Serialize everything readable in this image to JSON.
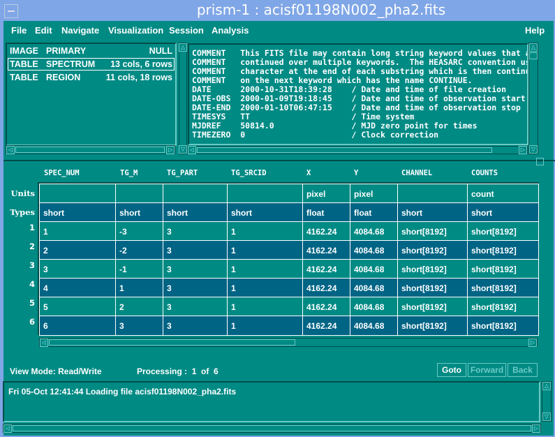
{
  "window": {
    "title": "prism-1  : acisf01198N002_pha2.fits"
  },
  "menu": [
    "File",
    "Edit",
    "Navigate",
    "Visualization",
    "Session",
    "Analysis",
    "Help"
  ],
  "hdus": [
    {
      "type": "IMAGE",
      "name": "PRIMARY",
      "info": "NULL"
    },
    {
      "type": "TABLE",
      "name": "SPECTRUM",
      "info": "13 cols, 6 rows",
      "selected": true
    },
    {
      "type": "TABLE",
      "name": "REGION",
      "info": "11 cols, 18 rows"
    }
  ],
  "header_lines": [
    "COMMENT   This FITS file may contain long string keyword values that a",
    "COMMENT   continued over multiple keywords.  The HEASARC convention us",
    "COMMENT   character at the end of each substring which is then continu",
    "COMMENT   on the next keyword which has the name CONTINUE.",
    "DATE      2000-10-31T18:39:28    / Date and time of file creation",
    "DATE-OBS  2000-01-09T19:18:45    / Date and time of observation start",
    "DATE-END  2000-01-10T06:47:15    / Date and time of observation stop",
    "TIMESYS   TT                     / Time system",
    "MJDREF    50814.0                / MJD zero point for times",
    "TIMEZERO  0                      / Clock correction"
  ],
  "table": {
    "columns": [
      "SPEC_NUM",
      "TG_M",
      "TG_PART",
      "TG_SRCID",
      "X",
      "Y",
      "CHANNEL",
      "COUNTS"
    ],
    "units_label": "Units",
    "types_label": "Types",
    "units": [
      "",
      "",
      "",
      "",
      "pixel",
      "pixel",
      "",
      "count"
    ],
    "types": [
      "short",
      "short",
      "short",
      "short",
      "float",
      "float",
      "short",
      "short"
    ],
    "rows": [
      {
        "n": "1",
        "cells": [
          "1",
          "-3",
          "3",
          "1",
          "4162.24",
          "4084.68",
          "short[8192]",
          "short[8192]"
        ]
      },
      {
        "n": "2",
        "cells": [
          "2",
          "-2",
          "3",
          "1",
          "4162.24",
          "4084.68",
          "short[8192]",
          "short[8192]"
        ]
      },
      {
        "n": "3",
        "cells": [
          "3",
          "-1",
          "3",
          "1",
          "4162.24",
          "4084.68",
          "short[8192]",
          "short[8192]"
        ]
      },
      {
        "n": "4",
        "cells": [
          "4",
          "1",
          "3",
          "1",
          "4162.24",
          "4084.68",
          "short[8192]",
          "short[8192]"
        ]
      },
      {
        "n": "5",
        "cells": [
          "5",
          "2",
          "3",
          "1",
          "4162.24",
          "4084.68",
          "short[8192]",
          "short[8192]"
        ]
      },
      {
        "n": "6",
        "cells": [
          "6",
          "3",
          "3",
          "1",
          "4162.24",
          "4084.68",
          "short[8192]",
          "short[8192]"
        ]
      }
    ]
  },
  "status": {
    "view_mode": "View Mode: Read/Write",
    "processing": "Processing :  1  of  6"
  },
  "buttons": {
    "goto": "Goto",
    "forward": "Forward",
    "back": "Back"
  },
  "log": "Fri 05-Oct 12:41:44 Loading file acisf01198N002_pha2.fits",
  "colors": {
    "bg": "#008a84",
    "alt_row": "#006485",
    "titlebar": "#7fa6e6"
  }
}
